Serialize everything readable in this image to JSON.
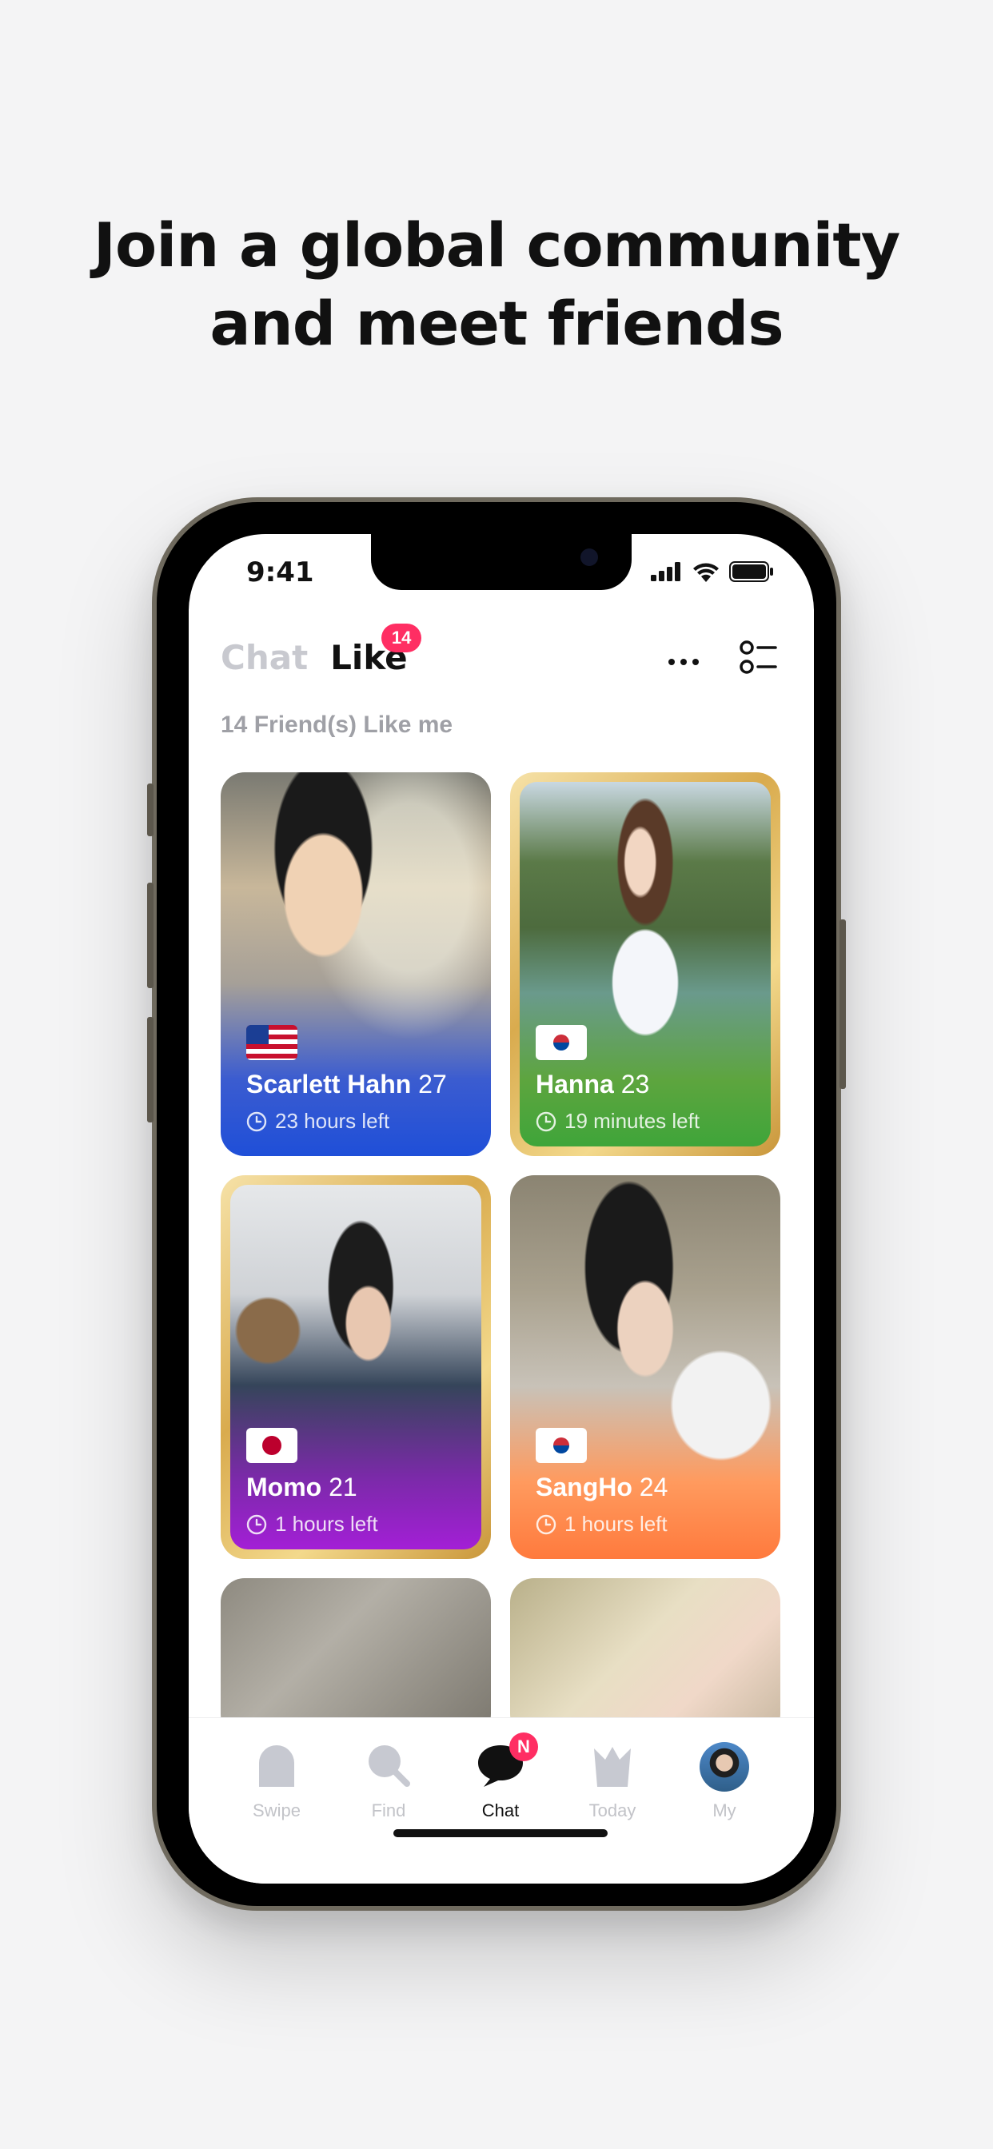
{
  "headline": [
    "Join a global community",
    "and meet friends"
  ],
  "status_bar": {
    "time": "9:41"
  },
  "header": {
    "tabs": [
      {
        "label": "Chat",
        "active": false
      },
      {
        "label": "Like",
        "active": true,
        "badge": "14"
      }
    ],
    "more_icon": "more-icon",
    "filter_icon": "filter-list-icon"
  },
  "subtitle": "14 Friend(s) Like me",
  "cards": [
    {
      "name": "Scarlett Hahn",
      "age": "27",
      "time_left": "23 hours left",
      "flag": "US",
      "accent": "#1f4fd8",
      "gold": false
    },
    {
      "name": "Hanna",
      "age": "23",
      "time_left": "19 minutes left",
      "flag": "KR",
      "accent": "#3fa53a",
      "gold": true
    },
    {
      "name": "Momo",
      "age": "21",
      "time_left": "1 hours left",
      "flag": "JP",
      "accent": "#a31fd6",
      "gold": true
    },
    {
      "name": "SangHo",
      "age": "24",
      "time_left": "1 hours left",
      "flag": "KR",
      "accent": "#ff7a3d",
      "gold": false
    }
  ],
  "tabbar": [
    {
      "label": "Swipe",
      "icon": "swipe-icon",
      "active": false
    },
    {
      "label": "Find",
      "icon": "search-icon",
      "active": false
    },
    {
      "label": "Chat",
      "icon": "chat-bubble-icon",
      "active": true,
      "badge": "N"
    },
    {
      "label": "Today",
      "icon": "crown-icon",
      "active": false
    },
    {
      "label": "My",
      "icon": "avatar-icon",
      "active": false
    }
  ],
  "colors": {
    "badge": "#ff2e63",
    "gold": "#e9c56b"
  }
}
